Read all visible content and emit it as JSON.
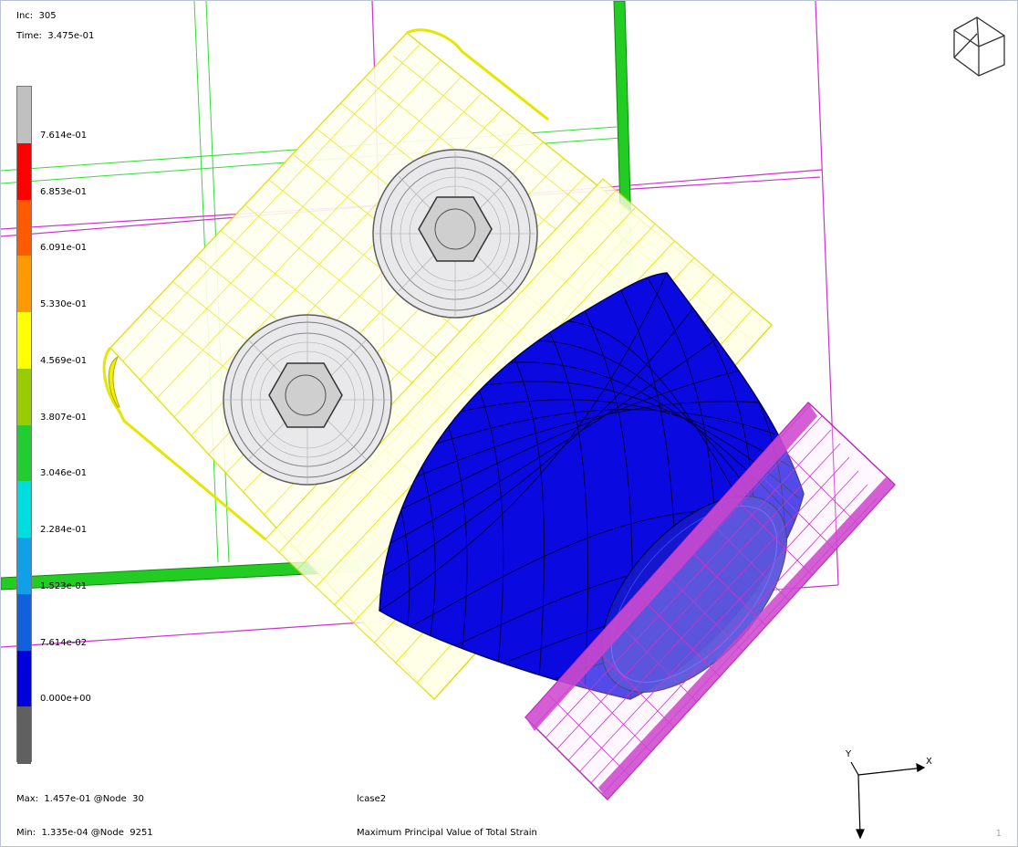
{
  "header": {
    "inc_label": "Inc:",
    "inc_value": "305",
    "time_label": "Time:",
    "time_value": "3.475e-01"
  },
  "legend": {
    "bands": [
      {
        "color": "#c0c0c0"
      },
      {
        "color": "#ff0000"
      },
      {
        "color": "#ff5a00"
      },
      {
        "color": "#ff9900"
      },
      {
        "color": "#ffff00"
      },
      {
        "color": "#99cc00"
      },
      {
        "color": "#22cc33"
      },
      {
        "color": "#00dddd"
      },
      {
        "color": "#10a0e8"
      },
      {
        "color": "#1060e0"
      },
      {
        "color": "#0000dd"
      },
      {
        "color": "#606060"
      }
    ],
    "ticks": [
      "7.614e-01",
      "6.853e-01",
      "6.091e-01",
      "5.330e-01",
      "4.569e-01",
      "3.807e-01",
      "3.046e-01",
      "2.284e-01",
      "1.523e-01",
      "7.614e-02",
      "0.000e+00"
    ]
  },
  "footer": {
    "max_text": "Max:  1.457e-01 @Node  30",
    "min_text": "Min:  1.335e-04 @Node  9251",
    "loadcase": "lcase2",
    "quantity": "Maximum Principal Value of Total Strain",
    "page_number": "1"
  },
  "axes": {
    "x_label": "X",
    "y_label": "Y"
  },
  "colors": {
    "wire_yellow": "#e6e600",
    "wire_green": "#22dd22",
    "wire_magenta": "#cc22cc",
    "part_blue": "#0a0ae0",
    "bolt_gray": "#9a9a9a"
  }
}
